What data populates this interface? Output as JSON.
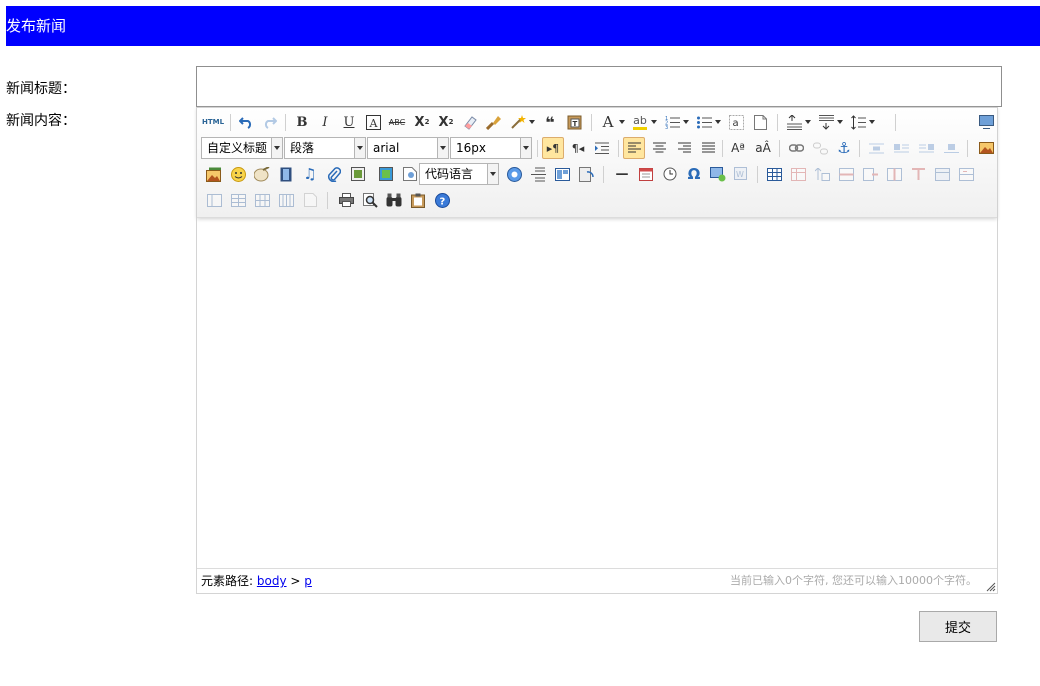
{
  "header": {
    "title": "发布新闻"
  },
  "form": {
    "title_label": "新闻标题：",
    "title_value": "",
    "content_label": "新闻内容：",
    "submit_label": "提交"
  },
  "toolbar": {
    "custom_heading": "自定义标题",
    "paragraph": "段落",
    "font_family": "arial",
    "font_size": "16px",
    "code_language": "代码语言",
    "source_icon_text": "HTML"
  },
  "statusbar": {
    "path_label": "元素路径:",
    "path_body": "body",
    "path_sep": ">",
    "path_p": "p",
    "word_count": "当前已输入0个字符, 您还可以输入10000个字符。"
  },
  "colors": {
    "header_bg": "#0000ff",
    "active_button_bg": "#ffe69f"
  }
}
